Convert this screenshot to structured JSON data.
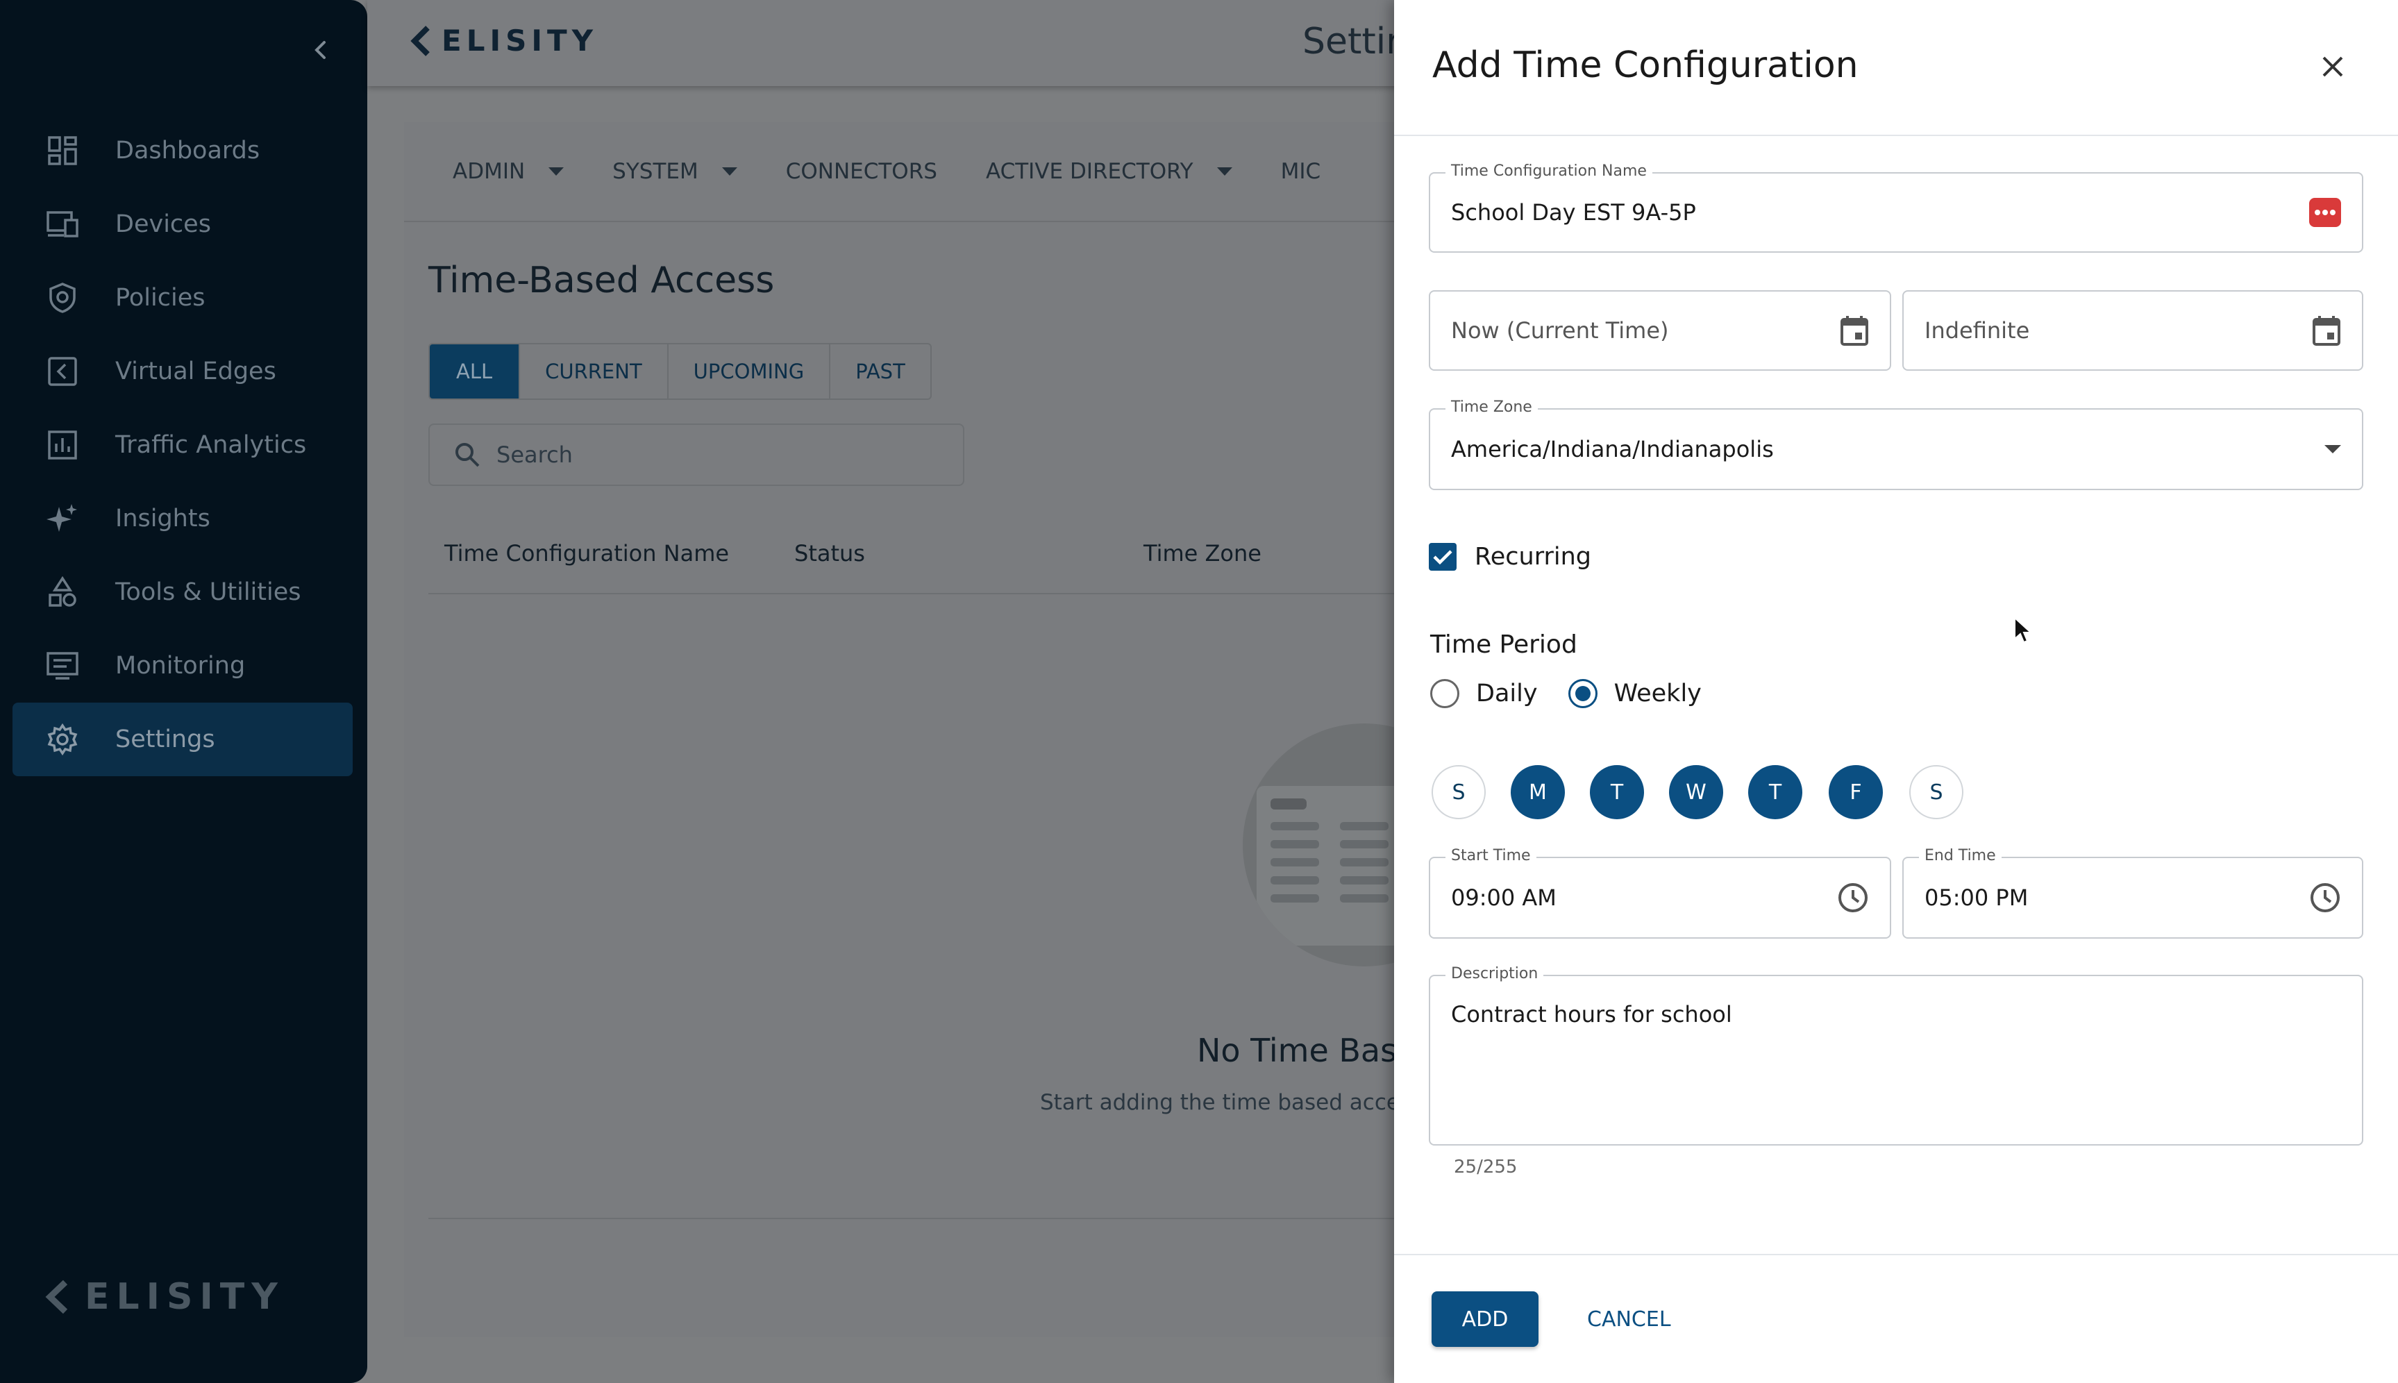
{
  "brand": {
    "name": "ELISITY"
  },
  "sidebar": {
    "items": [
      {
        "label": "Dashboards",
        "icon": "dashboard-icon"
      },
      {
        "label": "Devices",
        "icon": "devices-icon"
      },
      {
        "label": "Policies",
        "icon": "shield-icon"
      },
      {
        "label": "Virtual Edges",
        "icon": "virtual-edge-icon"
      },
      {
        "label": "Traffic Analytics",
        "icon": "analytics-icon"
      },
      {
        "label": "Insights",
        "icon": "sparkle-icon"
      },
      {
        "label": "Tools & Utilities",
        "icon": "tools-icon"
      },
      {
        "label": "Monitoring",
        "icon": "monitor-icon"
      },
      {
        "label": "Settings",
        "icon": "gear-icon",
        "active": true
      }
    ]
  },
  "header": {
    "title": "Settir"
  },
  "main": {
    "tabs": [
      {
        "label": "ADMIN",
        "has_menu": true
      },
      {
        "label": "SYSTEM",
        "has_menu": true
      },
      {
        "label": "CONNECTORS",
        "has_menu": false
      },
      {
        "label": "ACTIVE DIRECTORY",
        "has_menu": true
      },
      {
        "label": "MIC",
        "has_menu": false
      }
    ],
    "section_title": "Time-Based Access",
    "filters": [
      "ALL",
      "CURRENT",
      "UPCOMING",
      "PAST"
    ],
    "active_filter": "ALL",
    "search_placeholder": "Search",
    "columns": [
      "Time Configuration Name",
      "Status",
      "Time Zone"
    ],
    "empty_title": "No Time Base",
    "empty_subtitle": "Start adding the time based access"
  },
  "drawer": {
    "title": "Add Time Configuration",
    "name_field": {
      "label": "Time Configuration Name",
      "value": "School Day EST 9A-5P"
    },
    "start_date": {
      "placeholder": "Now (Current Time)"
    },
    "end_date": {
      "placeholder": "Indefinite"
    },
    "timezone": {
      "label": "Time Zone",
      "value": "America/Indiana/Indianapolis"
    },
    "recurring": {
      "label": "Recurring",
      "checked": true
    },
    "time_period": {
      "label": "Time Period",
      "options": [
        "Daily",
        "Weekly"
      ],
      "selected": "Weekly"
    },
    "days": [
      {
        "label": "S",
        "selected": false
      },
      {
        "label": "M",
        "selected": true
      },
      {
        "label": "T",
        "selected": true
      },
      {
        "label": "W",
        "selected": true
      },
      {
        "label": "T",
        "selected": true
      },
      {
        "label": "F",
        "selected": true
      },
      {
        "label": "S",
        "selected": false
      }
    ],
    "start_time": {
      "label": "Start Time",
      "value": "09:00 AM"
    },
    "end_time": {
      "label": "End Time",
      "value": "05:00 PM"
    },
    "description": {
      "label": "Description",
      "value": "Contract hours for school",
      "counter": "25/255"
    },
    "buttons": {
      "add": "ADD",
      "cancel": "CANCEL"
    }
  },
  "colors": {
    "primary": "#0b4f82",
    "sidebar_bg": "#04121d",
    "overlay": "#7b7d80",
    "error_icon": "#d93a3a"
  }
}
